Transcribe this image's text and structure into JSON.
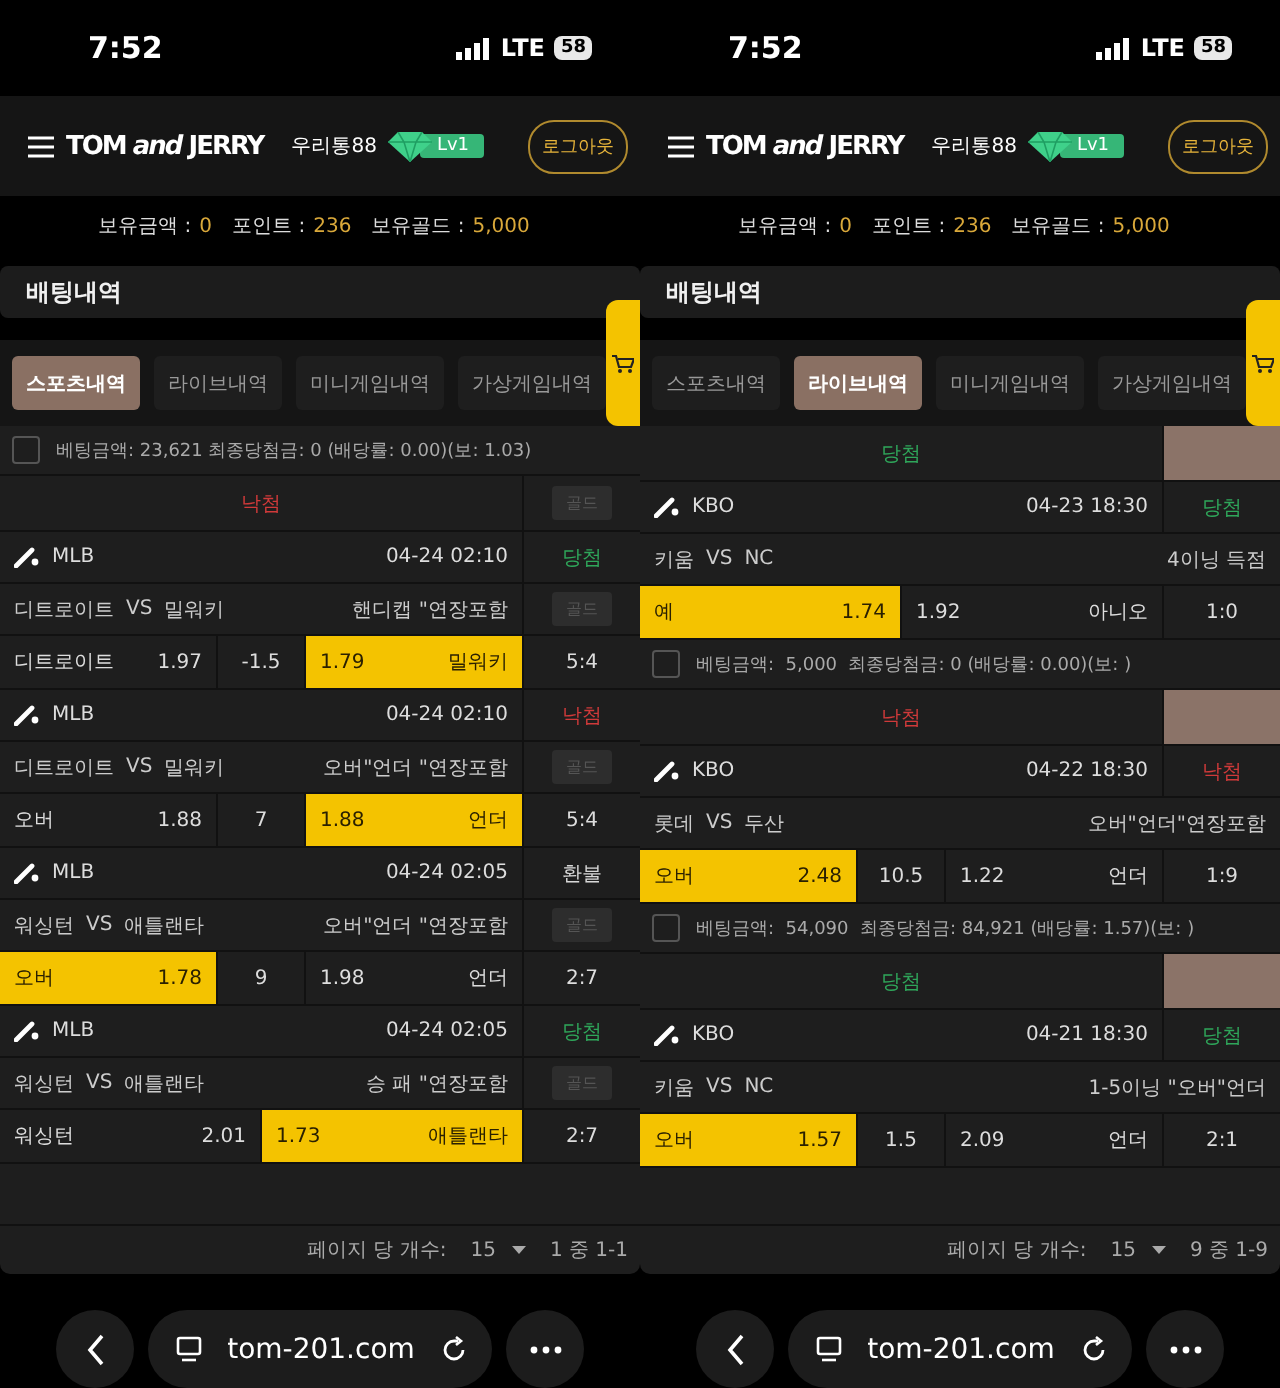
{
  "screens": [
    {
      "status_bar": {
        "time": "7:52",
        "network": "LTE",
        "battery": "58"
      },
      "header": {
        "logo": "TOM *and* JERRY",
        "username": "우리통88",
        "level": "Lv1",
        "logout": "로그아웃"
      },
      "balances": [
        {
          "label": "보유금액 :",
          "value": "0"
        },
        {
          "label": "포인트 :",
          "value": "236"
        },
        {
          "label": "보유골드 :",
          "value": "5,000"
        }
      ],
      "section_title": "배팅내역",
      "tabs": [
        {
          "label": "스포츠내역",
          "selected": true
        },
        {
          "label": "라이브내역",
          "selected": false
        },
        {
          "label": "미니게임내역",
          "selected": false
        },
        {
          "label": "가상게임내역",
          "selected": false
        }
      ],
      "items": [
        {
          "kind": "summary",
          "text": "베팅금액: 23,621 최종당첨금: 0 (배당률: 0.00)(보: 1.03)",
          "checked": false
        },
        {
          "kind": "result",
          "label": "낙첨",
          "color": "#d03a3a",
          "action": {
            "kind": "button",
            "label": "골드",
            "disabled": true
          }
        },
        {
          "kind": "bet",
          "league": "MLB",
          "time": "04-24 02:10",
          "status": "당첨",
          "color": "#2fa65a",
          "home": "디트로이트",
          "versus": "VS",
          "away": "밀워키",
          "market": "핸디캡 \"연장포함",
          "action": {
            "kind": "button",
            "label": "골드",
            "disabled": true
          },
          "options": [
            {
              "label": "디트로이트",
              "odds": "1.97",
              "selected": false
            },
            {
              "label": "밀워키",
              "odds": "1.79",
              "selected": true
            }
          ],
          "line": "-1.5",
          "score": "5:4"
        },
        {
          "kind": "bet",
          "league": "MLB",
          "time": "04-24 02:10",
          "status": "낙첨",
          "color": "#d03a3a",
          "home": "디트로이트",
          "versus": "VS",
          "away": "밀워키",
          "market": "오버\"언더 \"연장포함",
          "action": {
            "kind": "button",
            "label": "골드",
            "disabled": true
          },
          "options": [
            {
              "label": "오버",
              "odds": "1.88",
              "selected": false
            },
            {
              "label": "언더",
              "odds": "1.88",
              "selected": true
            }
          ],
          "line": "7",
          "score": "5:4"
        },
        {
          "kind": "bet",
          "league": "MLB",
          "time": "04-24 02:05",
          "status": "환불",
          "color": "#d8d8d8",
          "home": "워싱턴",
          "versus": "VS",
          "away": "애틀랜타",
          "market": "오버\"언더 \"연장포함",
          "action": {
            "kind": "button",
            "label": "골드",
            "disabled": true
          },
          "options": [
            {
              "label": "오버",
              "odds": "1.78",
              "selected": true
            },
            {
              "label": "언더",
              "odds": "1.98",
              "selected": false
            }
          ],
          "line": "9",
          "score": "2:7"
        },
        {
          "kind": "bet",
          "league": "MLB",
          "time": "04-24 02:05",
          "status": "당첨",
          "color": "#2fa65a",
          "home": "워싱턴",
          "versus": "VS",
          "away": "애틀랜타",
          "market": "승 패 \"연장포함",
          "action": {
            "kind": "button",
            "label": "골드",
            "disabled": true
          },
          "options": [
            {
              "label": "워싱턴",
              "odds": "2.01",
              "selected": false
            },
            {
              "label": "애틀랜타",
              "odds": "1.73",
              "selected": true
            }
          ],
          "score": "2:7"
        }
      ],
      "pagination": {
        "label": "페이지 당 개수:",
        "per_page": "15",
        "range": "1 중 1-1"
      },
      "browser": {
        "url": "tom-201.com"
      }
    },
    {
      "status_bar": {
        "time": "7:52",
        "network": "LTE",
        "battery": "58"
      },
      "header": {
        "logo": "TOM *and* JERRY",
        "username": "우리통88",
        "level": "Lv1",
        "logout": "로그아웃"
      },
      "balances": [
        {
          "label": "보유금액 :",
          "value": "0"
        },
        {
          "label": "포인트 :",
          "value": "236"
        },
        {
          "label": "보유골드 :",
          "value": "5,000"
        }
      ],
      "section_title": "배팅내역",
      "tabs": [
        {
          "label": "스포츠내역",
          "selected": false
        },
        {
          "label": "라이브내역",
          "selected": true
        },
        {
          "label": "미니게임내역",
          "selected": false
        },
        {
          "label": "가상게임내역",
          "selected": false
        }
      ],
      "items": [
        {
          "kind": "result",
          "label": "당첨",
          "color": "#2fa65a",
          "action": {
            "kind": "swatch"
          }
        },
        {
          "kind": "bet",
          "league": "KBO",
          "time": "04-23 18:30",
          "status": "당첨",
          "color": "#2fa65a",
          "home": "키움",
          "versus": "VS",
          "away": "NC",
          "market": "4이닝 득점",
          "options": [
            {
              "label": "예",
              "odds": "1.74",
              "selected": true
            },
            {
              "label": "아니오",
              "odds": "1.92",
              "selected": false
            }
          ],
          "score": "1:0"
        },
        {
          "kind": "summary",
          "text": "베팅금액:  5,000  최종당첨금: 0 (배당률: 0.00)(보: )",
          "checked": false
        },
        {
          "kind": "result",
          "label": "낙첨",
          "color": "#d03a3a",
          "action": {
            "kind": "swatch"
          }
        },
        {
          "kind": "bet",
          "league": "KBO",
          "time": "04-22 18:30",
          "status": "낙첨",
          "color": "#d03a3a",
          "home": "롯데",
          "versus": "VS",
          "away": "두산",
          "market": "오버\"언더\"연장포함",
          "options": [
            {
              "label": "오버",
              "odds": "2.48",
              "selected": true
            },
            {
              "label": "언더",
              "odds": "1.22",
              "selected": false
            }
          ],
          "line": "10.5",
          "score": "1:9"
        },
        {
          "kind": "summary",
          "text": "베팅금액:  54,090  최종당첨금: 84,921 (배당률: 1.57)(보: )",
          "checked": false
        },
        {
          "kind": "result",
          "label": "당첨",
          "color": "#2fa65a",
          "action": {
            "kind": "swatch"
          }
        },
        {
          "kind": "bet",
          "league": "KBO",
          "time": "04-21 18:30",
          "status": "당첨",
          "color": "#2fa65a",
          "home": "키움",
          "versus": "VS",
          "away": "NC",
          "market": "1-5이닝 \"오버\"언더",
          "options": [
            {
              "label": "오버",
              "odds": "1.57",
              "selected": true
            },
            {
              "label": "언더",
              "odds": "2.09",
              "selected": false
            }
          ],
          "line": "1.5",
          "score": "2:1"
        }
      ],
      "pagination": {
        "label": "페이지 당 개수:",
        "per_page": "15",
        "range": "9 중 1-9"
      },
      "browser": {
        "url": "tom-201.com"
      }
    }
  ]
}
